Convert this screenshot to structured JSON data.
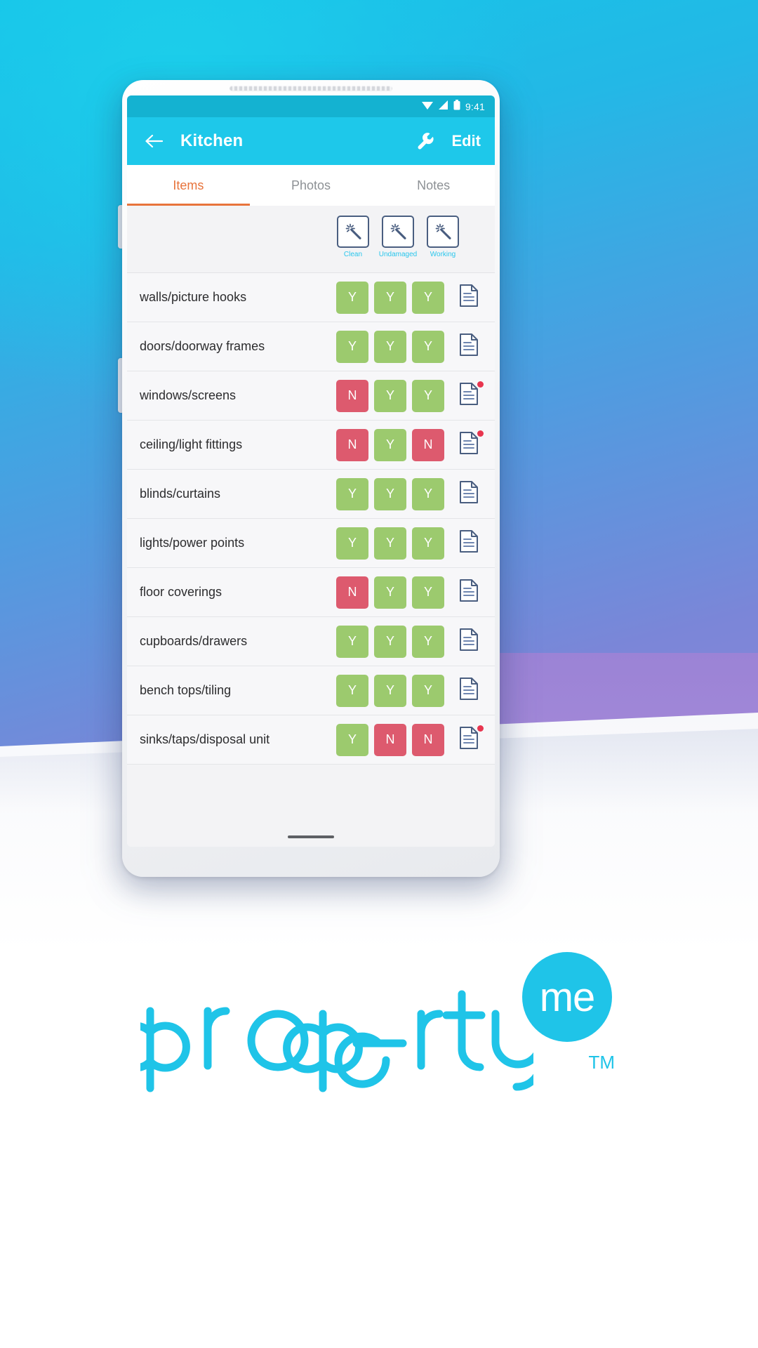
{
  "statusbar": {
    "time": "9:41",
    "icons": [
      "wifi-icon",
      "signal-icon",
      "battery-icon"
    ]
  },
  "appbar": {
    "back_icon": "arrow-left-icon",
    "title": "Kitchen",
    "tool_icon": "wrench-icon",
    "edit_label": "Edit",
    "background_color": "#1EC8EA"
  },
  "tabs": [
    {
      "label": "Items",
      "active": true
    },
    {
      "label": "Photos",
      "active": false
    },
    {
      "label": "Notes",
      "active": false
    }
  ],
  "columns": [
    {
      "label": "Clean",
      "icon": "magic-wand-icon"
    },
    {
      "label": "Undamaged",
      "icon": "magic-wand-icon"
    },
    {
      "label": "Working",
      "icon": "magic-wand-icon"
    }
  ],
  "rows": [
    {
      "label": "walls/picture hooks",
      "marks": [
        "Y",
        "Y",
        "Y"
      ],
      "note_icon": "document-icon",
      "note_badge": false
    },
    {
      "label": "doors/doorway frames",
      "marks": [
        "Y",
        "Y",
        "Y"
      ],
      "note_icon": "document-icon",
      "note_badge": false
    },
    {
      "label": "windows/screens",
      "marks": [
        "N",
        "Y",
        "Y"
      ],
      "note_icon": "document-icon",
      "note_badge": true
    },
    {
      "label": "ceiling/light fittings",
      "marks": [
        "N",
        "Y",
        "N"
      ],
      "note_icon": "document-icon",
      "note_badge": true
    },
    {
      "label": "blinds/curtains",
      "marks": [
        "Y",
        "Y",
        "Y"
      ],
      "note_icon": "document-icon",
      "note_badge": false
    },
    {
      "label": "lights/power points",
      "marks": [
        "Y",
        "Y",
        "Y"
      ],
      "note_icon": "document-icon",
      "note_badge": false
    },
    {
      "label": "floor coverings",
      "marks": [
        "N",
        "Y",
        "Y"
      ],
      "note_icon": "document-icon",
      "note_badge": false
    },
    {
      "label": "cupboards/drawers",
      "marks": [
        "Y",
        "Y",
        "Y"
      ],
      "note_icon": "document-icon",
      "note_badge": false
    },
    {
      "label": "bench tops/tiling",
      "marks": [
        "Y",
        "Y",
        "Y"
      ],
      "note_icon": "document-icon",
      "note_badge": false
    },
    {
      "label": "sinks/taps/disposal unit",
      "marks": [
        "Y",
        "N",
        "N"
      ],
      "note_icon": "document-icon",
      "note_badge": true
    }
  ],
  "logo": {
    "wordmark": "property",
    "badge_text": "me",
    "trademark": "TM",
    "color": "#1FC4E8"
  },
  "colors": {
    "accent_cyan": "#1EC8EA",
    "status_cyan": "#14B2D1",
    "tab_active": "#E8743C",
    "yes_green": "#9CCA6E",
    "no_red": "#DD5A6E",
    "label_cyan": "#29C6EC",
    "icon_navy": "#4A5E80",
    "badge_red": "#E8354F"
  }
}
